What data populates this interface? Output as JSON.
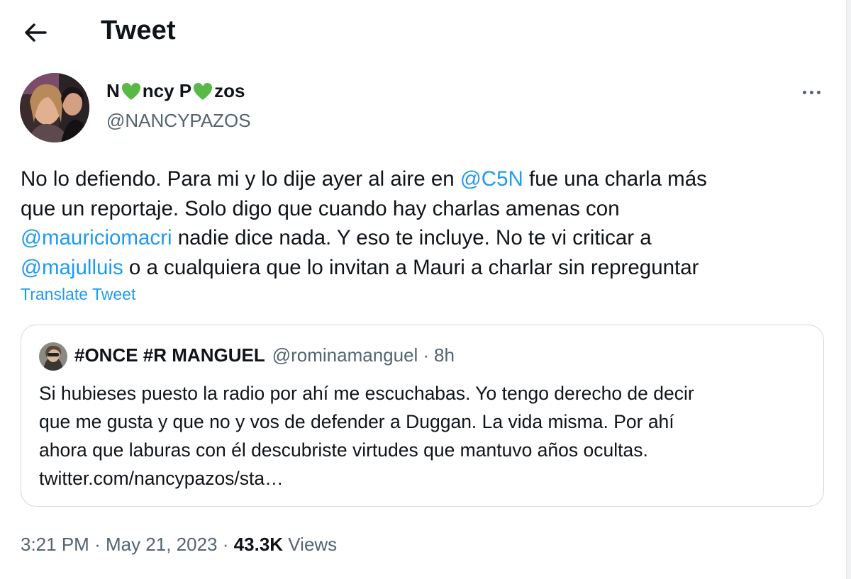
{
  "header": {
    "title": "Tweet",
    "back_icon": "arrow-left-icon"
  },
  "author": {
    "name_parts": [
      "N",
      "ncy P",
      "zos"
    ],
    "heart_color": "#58b947",
    "handle": "@NANCYPAZOS"
  },
  "tweet": {
    "lines": [
      [
        {
          "text": "No lo defiendo. Para mi y lo dije ayer al aire en "
        },
        {
          "text": "@C5N",
          "mention": true
        },
        {
          "text": " fue una charla más"
        }
      ],
      [
        {
          "text": "que un reportaje. Solo digo que cuando hay charlas amenas con"
        }
      ],
      [
        {
          "text": "@mauriciomacri",
          "mention": true
        },
        {
          "text": " nadie dice nada. Y eso te incluye. No te vi criticar a"
        }
      ],
      [
        {
          "text": "@majulluis",
          "mention": true
        },
        {
          "text": " o a cualquiera que lo invitan a Mauri a charlar sin repreguntar"
        }
      ]
    ],
    "translate_label": "Translate Tweet"
  },
  "quote": {
    "name": "#ONCE #R MANGUEL",
    "handle": "@rominamanguel",
    "separator": "·",
    "time": "8h",
    "lines": [
      "Si hubieses puesto la radio por ahí me escuchabas. Yo tengo derecho de decir",
      "que me gusta y que no y vos de defender a Duggan. La vida misma. Por ahí",
      "ahora que laburas con él descubriste virtudes que mantuvo años ocultas.",
      "twitter.com/nancypazos/sta…"
    ]
  },
  "meta": {
    "time": "3:21 PM",
    "separator": "·",
    "date": "May 21, 2023",
    "views_count": "43.3K",
    "views_label": "Views"
  },
  "colors": {
    "accent": "#1d9bf0",
    "secondary_text": "#536471",
    "border": "#cfd9de"
  }
}
